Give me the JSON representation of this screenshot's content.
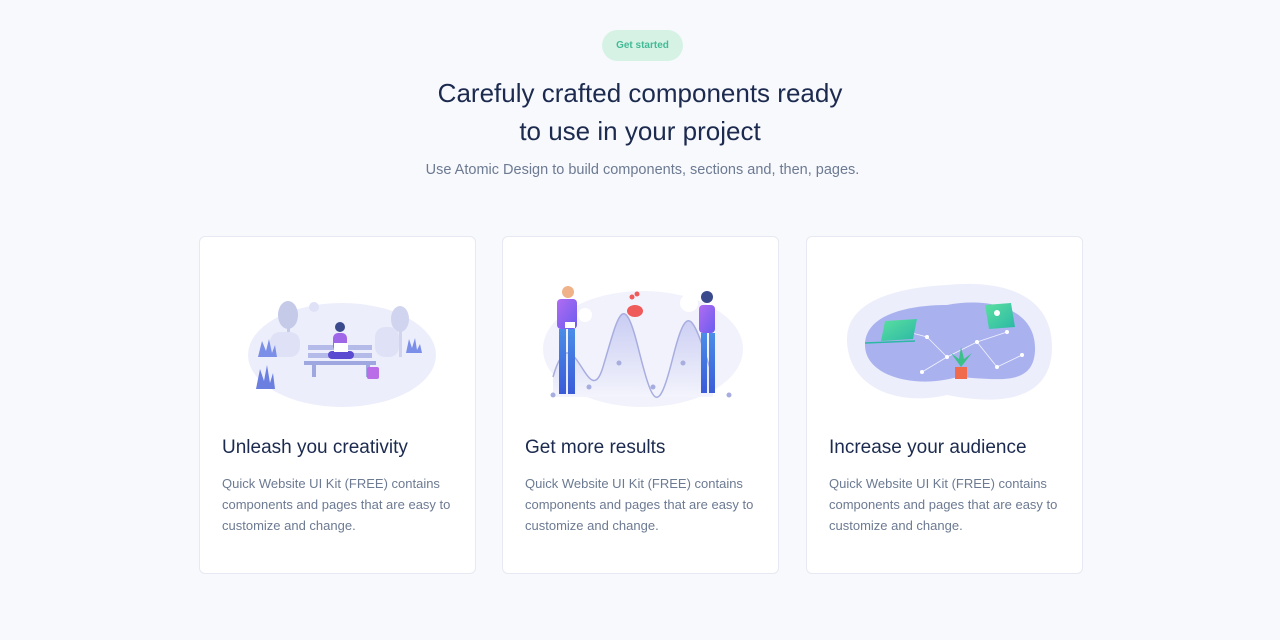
{
  "badge": {
    "label": "Get started"
  },
  "headline": {
    "line1": "Carefuly crafted components ready",
    "line2": "to use in your project"
  },
  "subtitle": "Use Atomic Design to build components, sections and, then, pages.",
  "cards": [
    {
      "title": "Unleash you creativity",
      "text": "Quick Website UI Kit (FREE) contains components and pages that are easy to customize and change.",
      "illustration": "park-bench-laptop-illustration"
    },
    {
      "title": "Get more results",
      "text": "Quick Website UI Kit (FREE) contains components and pages that are easy to customize and change.",
      "illustration": "growth-chart-people-illustration"
    },
    {
      "title": "Increase your audience",
      "text": "Quick Website UI Kit (FREE) contains components and pages that are easy to customize and change.",
      "illustration": "network-constellation-illustration"
    }
  ],
  "colors": {
    "background": "#f8f9fd",
    "heading": "#1b2a4e",
    "muted_text": "#6c7a92",
    "badge_bg": "#d6f2e5",
    "badge_text": "#42ba96",
    "accent_purple": "#8c6ce5",
    "accent_blue": "#5b7cfa"
  }
}
